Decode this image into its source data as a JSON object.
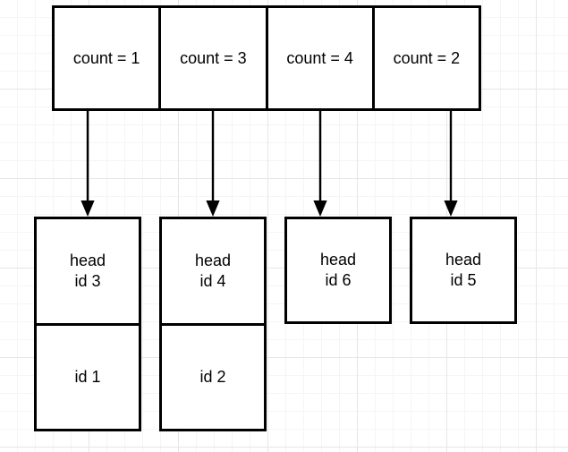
{
  "diagram": {
    "title": "hash-table-buckets-diagram",
    "colors": {
      "stroke": "#000000",
      "background": "#ffffff",
      "grid_minor": "#f5f5f5",
      "grid_major": "#e6e6e6"
    },
    "counters": {
      "cells": [
        {
          "label": "count = 1"
        },
        {
          "label": "count = 3"
        },
        {
          "label": "count = 4"
        },
        {
          "label": "count = 2"
        }
      ]
    },
    "arrows": [
      {
        "name": "arrow-to-bucket-1"
      },
      {
        "name": "arrow-to-bucket-2"
      },
      {
        "name": "arrow-to-bucket-3"
      },
      {
        "name": "arrow-to-bucket-4"
      }
    ],
    "buckets": [
      {
        "name": "bucket-1",
        "slots": [
          {
            "line1": "head",
            "line2": "id 3"
          },
          {
            "line1": "",
            "line2": "id 1"
          }
        ]
      },
      {
        "name": "bucket-2",
        "slots": [
          {
            "line1": "head",
            "line2": "id 4"
          },
          {
            "line1": "",
            "line2": "id 2"
          }
        ]
      },
      {
        "name": "bucket-3",
        "slots": [
          {
            "line1": "head",
            "line2": "id 6"
          }
        ]
      },
      {
        "name": "bucket-4",
        "slots": [
          {
            "line1": "head",
            "line2": "id 5"
          }
        ]
      }
    ]
  }
}
